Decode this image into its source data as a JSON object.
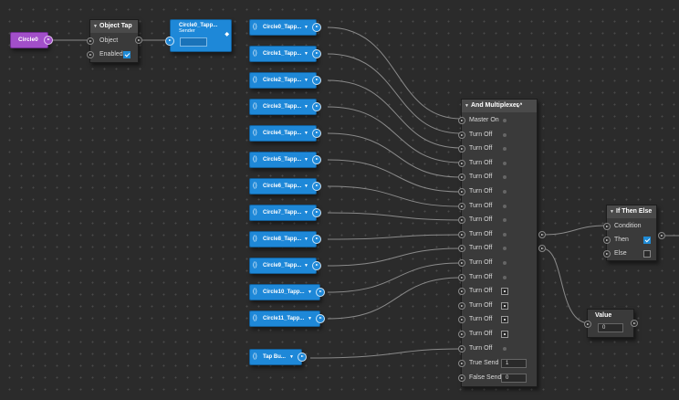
{
  "circle0_node": {
    "label": "Circle0"
  },
  "object_tap": {
    "title": "Object Tap",
    "object_label": "Object",
    "enabled_label": "Enabled"
  },
  "sender_main": {
    "title": "Circle0_Tapp...",
    "subtitle": "Sender"
  },
  "senders": [
    {
      "label": "Circle0_Tapp..."
    },
    {
      "label": "Circle1_Tapp..."
    },
    {
      "label": "Circle2_Tapp..."
    },
    {
      "label": "Circle3_Tapp..."
    },
    {
      "label": "Circle4_Tapp..."
    },
    {
      "label": "Circle5_Tapp..."
    },
    {
      "label": "Circle6_Tapp..."
    },
    {
      "label": "Circle7_Tapp..."
    },
    {
      "label": "Circle8_Tapp..."
    },
    {
      "label": "Circle9_Tapp..."
    },
    {
      "label": "Circle10_Tapp..."
    },
    {
      "label": "Circle11_Tapp..."
    },
    {
      "label": "Tap Bu..."
    }
  ],
  "dropdown_icon": "chevron-down-icon",
  "and_mux": {
    "title": "And Multiplexer",
    "master_label": "Master On",
    "turn_off_label": "Turn Off",
    "true_send_label": "True Send",
    "false_send_label": "False Send",
    "true_send_value": "1",
    "false_send_value": "0"
  },
  "if_then_else": {
    "title": "If Then Else",
    "condition_label": "Condition",
    "then_label": "Then",
    "else_label": "Else"
  },
  "value_node": {
    "title": "Value",
    "value": "0"
  },
  "colors": {
    "accent": "#1e88d8",
    "purple": "#a24fc9",
    "node_bg": "#3a3a3a"
  }
}
